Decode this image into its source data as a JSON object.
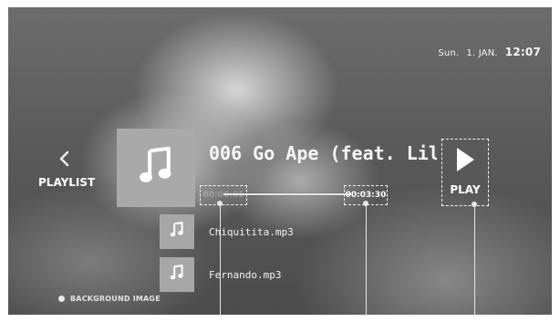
{
  "status": {
    "day": "Sun.",
    "date": "1. JAN.",
    "time": "12:07"
  },
  "sidebar": {
    "back_icon": "chevron-left-icon",
    "playlist_label": "PLAYLIST"
  },
  "now_playing": {
    "title": "006 Go Ape (feat. Lil' ",
    "album_icon": "music-note-icon",
    "current_time": "00:00:01",
    "total_time": "00:03:30",
    "play_icon": "play-icon",
    "play_label": "PLAY"
  },
  "playlist": {
    "items": [
      {
        "label": "Chiquitita.mp3",
        "icon": "music-note-icon"
      },
      {
        "label": "Fernando.mp3",
        "icon": "music-note-icon"
      }
    ]
  },
  "background": {
    "label": "BACKGROUND IMAGE"
  },
  "colors": {
    "overlay": "#5a5a5a",
    "thumb_bg": "#a9a9a9",
    "text": "#ffffff"
  }
}
